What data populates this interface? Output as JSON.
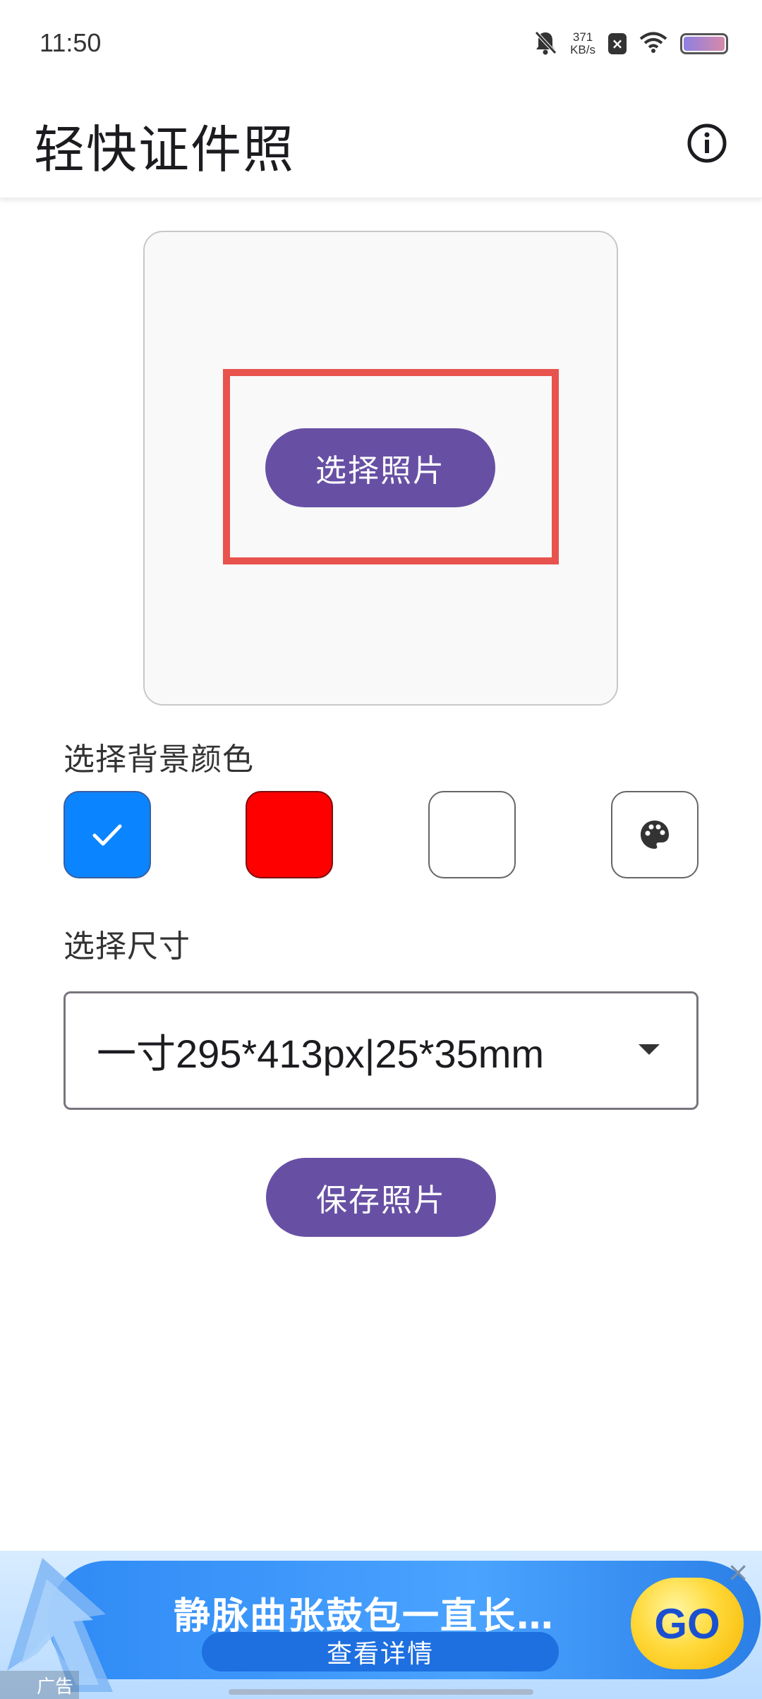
{
  "status_bar": {
    "time": "11:50",
    "net_speed_value": "371",
    "net_speed_unit": "KB/s",
    "icons": [
      "mute-bell-icon",
      "close-box-icon",
      "wifi-icon",
      "battery-icon"
    ]
  },
  "app_bar": {
    "title": "轻快证件照",
    "info_icon": "info-icon"
  },
  "photo_area": {
    "select_photo_label": "选择照片",
    "highlight_color": "#e8534e"
  },
  "background": {
    "label": "选择背景颜色",
    "swatches": [
      {
        "name": "blue",
        "color": "#0a84ff",
        "selected": true
      },
      {
        "name": "red",
        "color": "#ff0000",
        "selected": false
      },
      {
        "name": "white",
        "color": "#ffffff",
        "selected": false
      },
      {
        "name": "custom",
        "icon": "palette-icon",
        "selected": false
      }
    ]
  },
  "size": {
    "label": "选择尺寸",
    "selected_value": "一寸295*413px|25*35mm"
  },
  "actions": {
    "save_photo_label": "保存照片"
  },
  "ad": {
    "headline": "静脉曲张鼓包一直长…",
    "cta": "查看详情",
    "go_label": "GO",
    "tag": "广告",
    "close_glyph": "×"
  },
  "colors": {
    "primary": "#6750a4",
    "outline": "#79747e"
  }
}
